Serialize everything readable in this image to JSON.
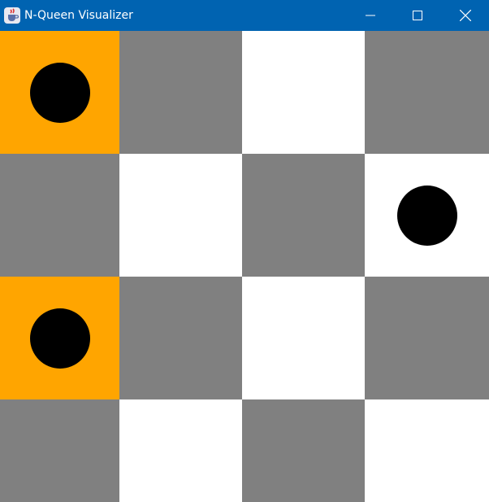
{
  "window": {
    "title": "N-Queen Visualizer",
    "app_icon": "java-cup-icon",
    "controls": {
      "minimize": "minimize-icon",
      "maximize": "maximize-icon",
      "close": "close-icon"
    }
  },
  "colors": {
    "titlebar": "#0063b1",
    "light_square": "#ffffff",
    "dark_square": "#808080",
    "highlight_square": "#ffa500",
    "queen": "#000000"
  },
  "board": {
    "size": 4,
    "rows": [
      [
        {
          "shade": "highlight",
          "queen": true
        },
        {
          "shade": "dark",
          "queen": false
        },
        {
          "shade": "light",
          "queen": false
        },
        {
          "shade": "dark",
          "queen": false
        }
      ],
      [
        {
          "shade": "dark",
          "queen": false
        },
        {
          "shade": "light",
          "queen": false
        },
        {
          "shade": "dark",
          "queen": false
        },
        {
          "shade": "light",
          "queen": true
        }
      ],
      [
        {
          "shade": "highlight",
          "queen": true
        },
        {
          "shade": "dark",
          "queen": false
        },
        {
          "shade": "light",
          "queen": false
        },
        {
          "shade": "dark",
          "queen": false
        }
      ],
      [
        {
          "shade": "dark",
          "queen": false
        },
        {
          "shade": "light",
          "queen": false
        },
        {
          "shade": "dark",
          "queen": false
        },
        {
          "shade": "light",
          "queen": false
        }
      ]
    ]
  }
}
